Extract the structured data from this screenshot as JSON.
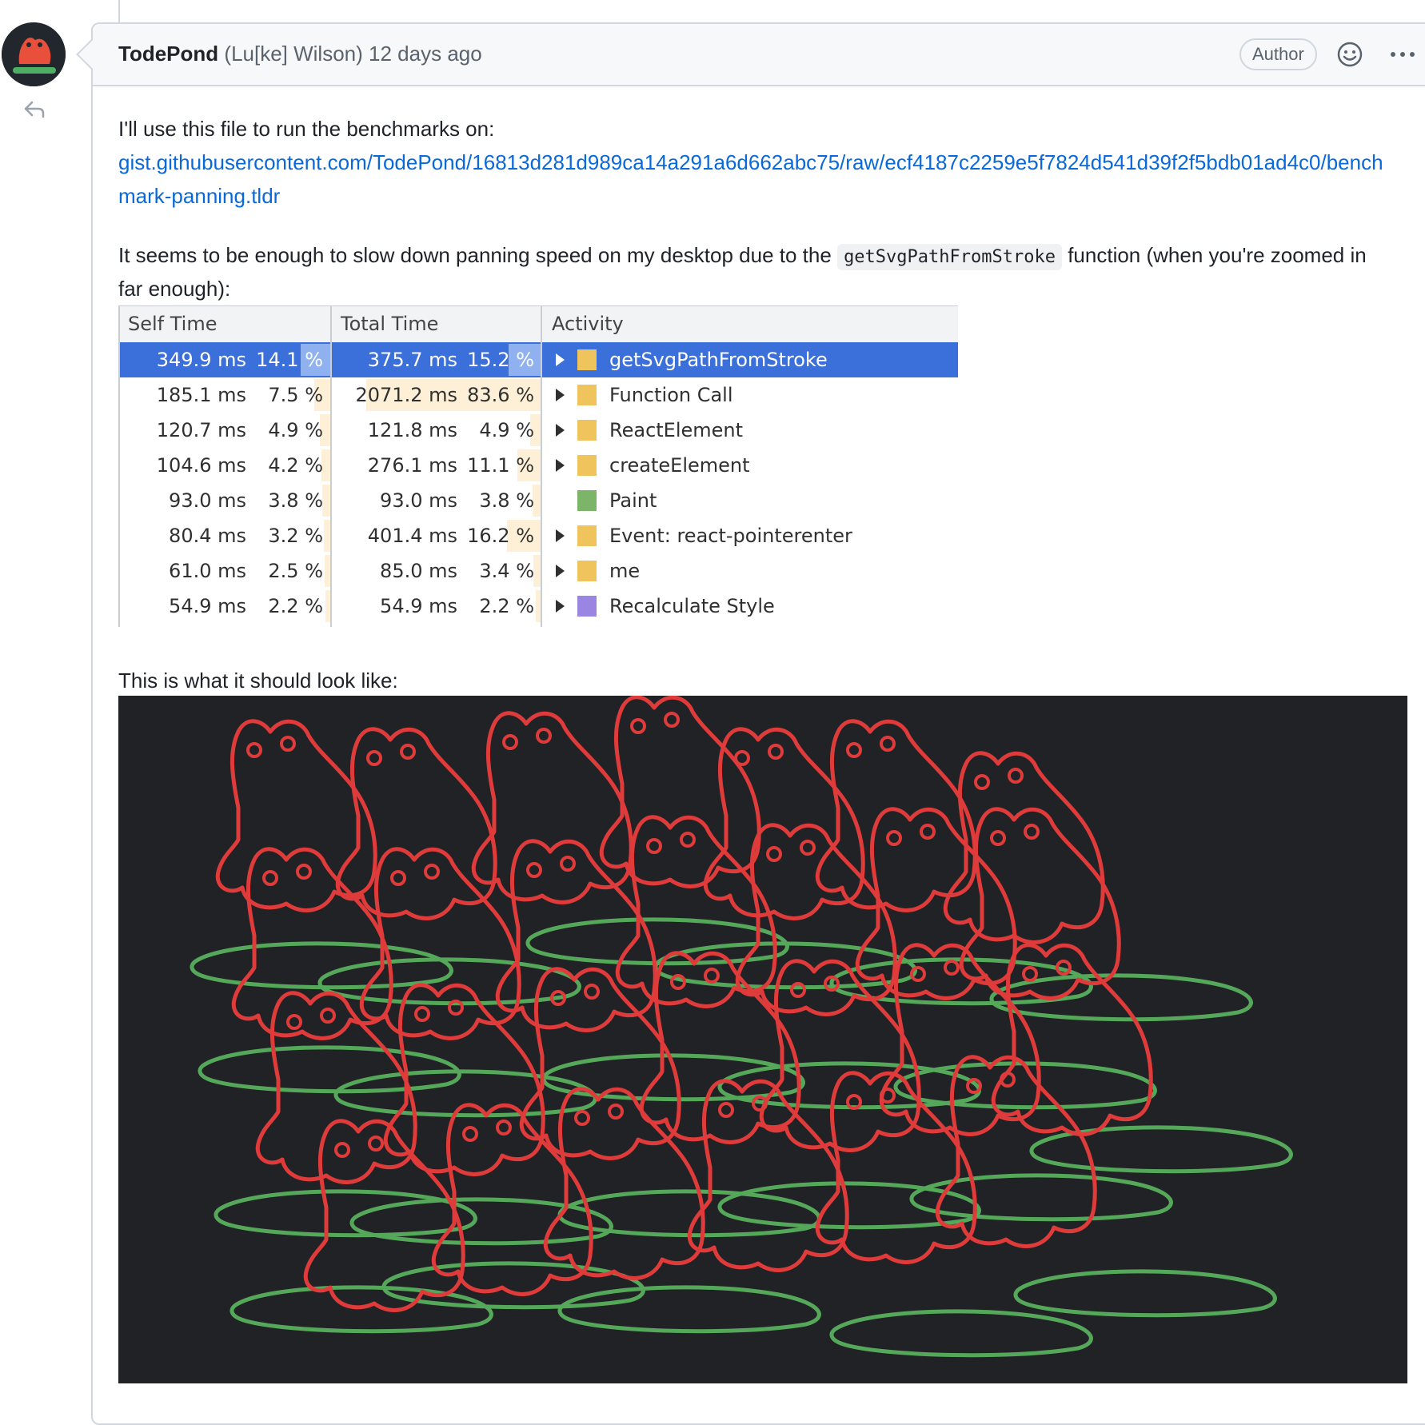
{
  "comment": {
    "author": "TodePond",
    "full_name": "(Lu[ke] Wilson)",
    "time": "12 days ago",
    "badge": "Author"
  },
  "body": {
    "intro": "I'll use this file to run the benchmarks on:",
    "link_line1": "gist.githubusercontent.com/TodePond/16813d281d989ca14a291a6d662abc75/raw/ecf4187c2259e5f7824d541d39f2f5bdb01ad4c0/bench",
    "link_line2": "mark-panning.tldr",
    "para2_before": "It seems to be enough to slow down panning speed on my desktop due to the",
    "para2_code": "getSvgPathFromStroke",
    "para2_after": "function (when you're zoomed in",
    "para2_line2": "far enough):",
    "para3": "This is what it should look like:"
  },
  "profiler": {
    "headers": {
      "self": "Self Time",
      "total": "Total Time",
      "activity": "Activity"
    },
    "rows": [
      {
        "self_ms": "349.9 ms",
        "self_pct": "14.1 %",
        "total_ms": "375.7 ms",
        "total_pct": "15.2 %",
        "activity": "getSvgPathFromStroke",
        "self_fraction": 0.141,
        "total_fraction": 0.152,
        "color": "#f0c45c",
        "expandable": true,
        "selected": true
      },
      {
        "self_ms": "185.1 ms",
        "self_pct": "7.5 %",
        "total_ms": "2071.2 ms",
        "total_pct": "83.6 %",
        "activity": "Function Call",
        "self_fraction": 0.075,
        "total_fraction": 0.836,
        "color": "#f0c45c",
        "expandable": true,
        "selected": false
      },
      {
        "self_ms": "120.7 ms",
        "self_pct": "4.9 %",
        "total_ms": "121.8 ms",
        "total_pct": "4.9 %",
        "activity": "ReactElement",
        "self_fraction": 0.049,
        "total_fraction": 0.049,
        "color": "#f0c45c",
        "expandable": true,
        "selected": false
      },
      {
        "self_ms": "104.6 ms",
        "self_pct": "4.2 %",
        "total_ms": "276.1 ms",
        "total_pct": "11.1 %",
        "activity": "createElement",
        "self_fraction": 0.042,
        "total_fraction": 0.111,
        "color": "#f0c45c",
        "expandable": true,
        "selected": false
      },
      {
        "self_ms": "93.0 ms",
        "self_pct": "3.8 %",
        "total_ms": "93.0 ms",
        "total_pct": "3.8 %",
        "activity": "Paint",
        "self_fraction": 0.038,
        "total_fraction": 0.038,
        "color": "#7cb46a",
        "expandable": false,
        "selected": false
      },
      {
        "self_ms": "80.4 ms",
        "self_pct": "3.2 %",
        "total_ms": "401.4 ms",
        "total_pct": "16.2 %",
        "activity": "Event: react-pointerenter",
        "self_fraction": 0.032,
        "total_fraction": 0.162,
        "color": "#f0c45c",
        "expandable": true,
        "selected": false
      },
      {
        "self_ms": "61.0 ms",
        "self_pct": "2.5 %",
        "total_ms": "85.0 ms",
        "total_pct": "3.4 %",
        "activity": "me",
        "self_fraction": 0.025,
        "total_fraction": 0.034,
        "color": "#f0c45c",
        "expandable": true,
        "selected": false
      },
      {
        "self_ms": "54.9 ms",
        "self_pct": "2.2 %",
        "total_ms": "54.9 ms",
        "total_pct": "2.2 %",
        "activity": "Recalculate Style",
        "self_fraction": 0.022,
        "total_fraction": 0.022,
        "color": "#9b85e3",
        "expandable": true,
        "selected": false
      }
    ]
  },
  "colors": {
    "link": "#0969da",
    "canvas_bg": "#212225",
    "frog_stroke": "#e03b3b",
    "lily_stroke": "#55a85a",
    "selected_row": "#3b6fd9"
  },
  "icons": {
    "reply": "reply-arrow-icon",
    "emoji": "smiley-face-icon",
    "menu": "kebab-more-icon"
  }
}
